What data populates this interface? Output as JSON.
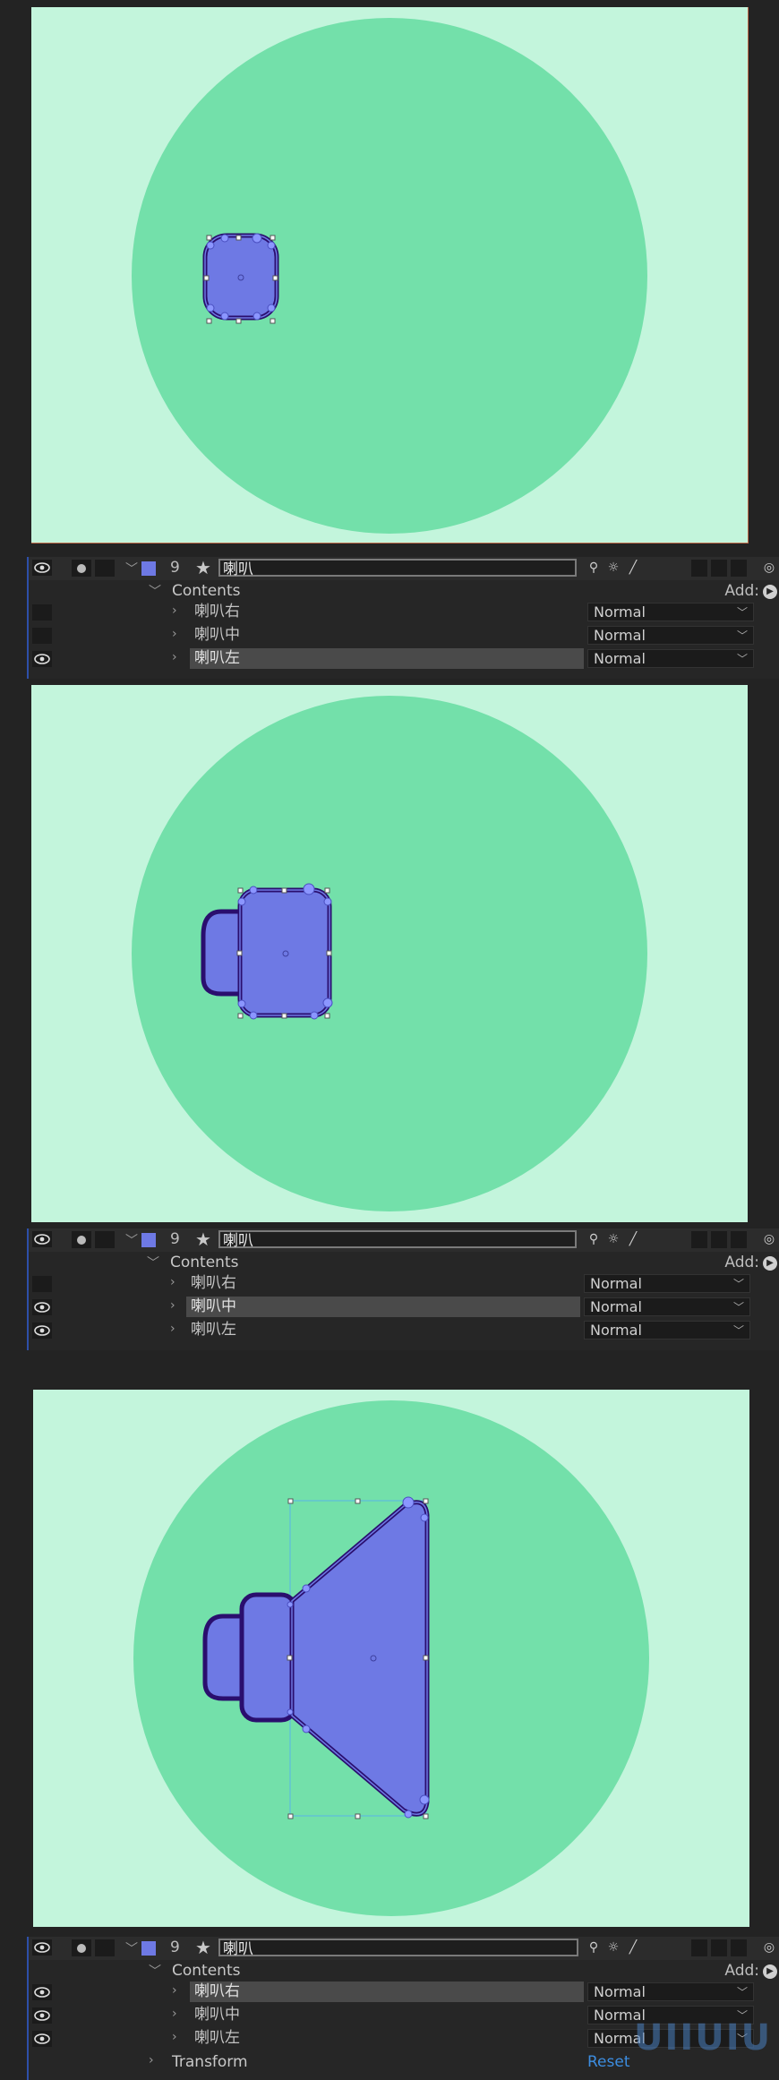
{
  "colors": {
    "background": "#232323",
    "canvas_bg": "#c3f5dc",
    "circle": "#73e0aa",
    "shape_fill": "#6e79e4",
    "shape_stroke": "#2a0e6e",
    "label_color": "#6e79e4",
    "accent_blue": "#3c8de0"
  },
  "panels": [
    {
      "layer_number": "9",
      "layer_name": "喇叭",
      "contents_label": "Contents",
      "add_label": "Add:",
      "items": [
        {
          "name": "喇叭右",
          "blend": "Normal",
          "visible": false,
          "selected": false
        },
        {
          "name": "喇叭中",
          "blend": "Normal",
          "visible": false,
          "selected": false
        },
        {
          "name": "喇叭左",
          "blend": "Normal",
          "visible": true,
          "selected": true
        }
      ]
    },
    {
      "layer_number": "9",
      "layer_name": "喇叭",
      "contents_label": "Contents",
      "add_label": "Add:",
      "items": [
        {
          "name": "喇叭右",
          "blend": "Normal",
          "visible": false,
          "selected": false
        },
        {
          "name": "喇叭中",
          "blend": "Normal",
          "visible": true,
          "selected": true
        },
        {
          "name": "喇叭左",
          "blend": "Normal",
          "visible": true,
          "selected": false
        }
      ]
    },
    {
      "layer_number": "9",
      "layer_name": "喇叭",
      "contents_label": "Contents",
      "add_label": "Add:",
      "items": [
        {
          "name": "喇叭右",
          "blend": "Normal",
          "visible": true,
          "selected": true
        },
        {
          "name": "喇叭中",
          "blend": "Normal",
          "visible": true,
          "selected": false
        },
        {
          "name": "喇叭左",
          "blend": "Normal",
          "visible": true,
          "selected": false
        }
      ],
      "transform_label": "Transform",
      "reset_label": "Reset"
    }
  ],
  "watermark": "UIIUIU"
}
